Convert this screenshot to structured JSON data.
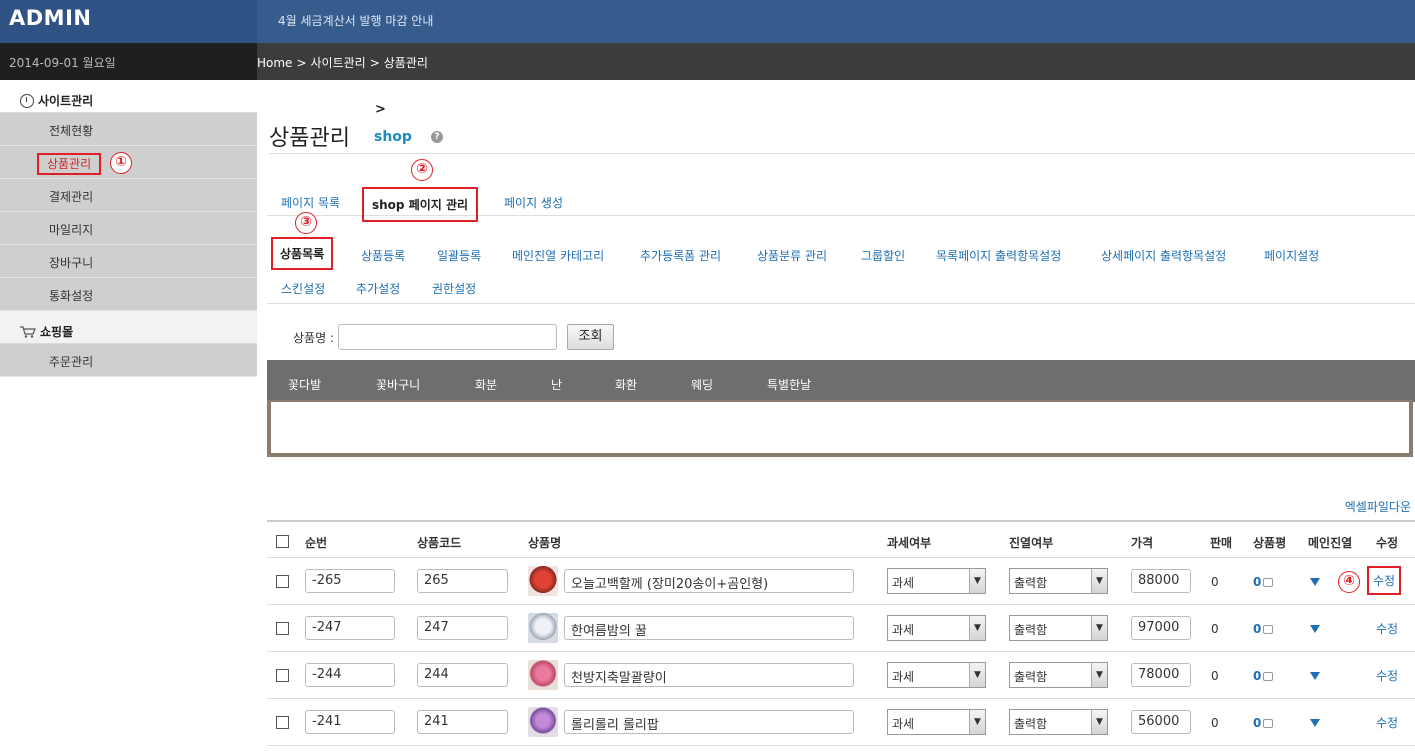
{
  "app": {
    "logo": "ADMIN",
    "notice": "4월 세금계산서 발행 마감 안내",
    "date": "2014-09-01 월요일"
  },
  "breadcrumb": [
    "Home",
    "사이트관리",
    "상품관리"
  ],
  "sidebar": {
    "sections": [
      {
        "label": "사이트관리",
        "icon": "clock-icon",
        "items": [
          "전체현황",
          "상품관리",
          "결제관리",
          "마일리지",
          "장바구니",
          "통화설정"
        ]
      },
      {
        "label": "쇼핑몰",
        "icon": "cart-icon",
        "items": [
          "주문관리"
        ]
      }
    ],
    "active_item": "상품관리"
  },
  "page": {
    "title": "상품관리",
    "arrow": ">",
    "shop": "shop"
  },
  "markers": [
    "①",
    "②",
    "③",
    "④"
  ],
  "tabs": [
    "페이지 목록",
    "shop 페이지 관리",
    "페이지 생성"
  ],
  "subtabs": [
    "상품목록",
    "상품등록",
    "일괄등록",
    "메인진열 카테고리",
    "추가등록폼 관리",
    "상품분류 관리",
    "그룹할인",
    "목록페이지 출력항목설정",
    "상세페이지 출력항목설정",
    "페이지설정",
    "스킨설정",
    "추가설정",
    "권한설정"
  ],
  "search": {
    "label": "상품명 :",
    "value": "",
    "button": "조회"
  },
  "categories": [
    "꽃다발",
    "꽃바구니",
    "화분",
    "난",
    "화환",
    "웨딩",
    "특별한날"
  ],
  "excel_link": "엑셀파일다운",
  "table": {
    "headers": [
      "순번",
      "상품코드",
      "상품명",
      "과세여부",
      "진열여부",
      "가격",
      "판매",
      "상품평",
      "메인진열",
      "수정"
    ],
    "rows": [
      {
        "seq": "-265",
        "code": "265",
        "name": "오늘고백할께 (장미20송이+곰인형)",
        "tax": "과세",
        "display": "출력함",
        "price": "88000",
        "sales": "0",
        "reviews": "0",
        "edit": "수정",
        "thumb": "#c4382c"
      },
      {
        "seq": "-247",
        "code": "247",
        "name": "한여름밤의 꿀",
        "tax": "과세",
        "display": "출력함",
        "price": "97000",
        "sales": "0",
        "reviews": "0",
        "edit": "수정",
        "thumb": "#b9c3cf"
      },
      {
        "seq": "-244",
        "code": "244",
        "name": "천방지축말괄량이",
        "tax": "과세",
        "display": "출력함",
        "price": "78000",
        "sales": "0",
        "reviews": "0",
        "edit": "수정",
        "thumb": "#d26b8a"
      },
      {
        "seq": "-241",
        "code": "241",
        "name": "롤리롤리 롤리팝",
        "tax": "과세",
        "display": "출력함",
        "price": "56000",
        "sales": "0",
        "reviews": "0",
        "edit": "수정",
        "thumb": "#a97bc4"
      }
    ]
  }
}
